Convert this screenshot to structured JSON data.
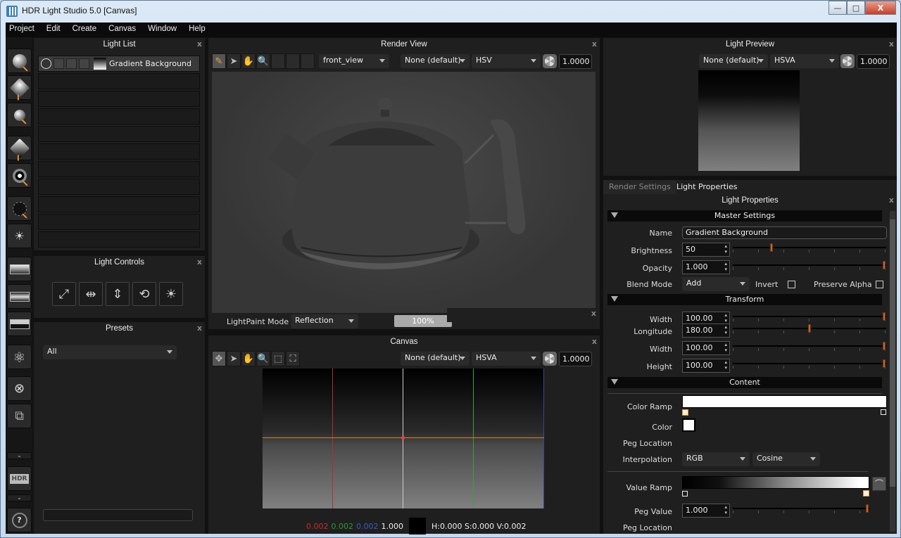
{
  "window": {
    "title": "HDR Light Studio 5.0 [Canvas]",
    "controls": {
      "minimize": "—",
      "maximize": "□",
      "close": "X"
    }
  },
  "menubar": [
    "Project",
    "Edit",
    "Create",
    "Canvas",
    "Window",
    "Help"
  ],
  "left_toolbar": {
    "buttons": [
      "add-light-circle",
      "add-light-rect",
      "add-light-spot",
      "add-light-diamond",
      "add-light-pattern",
      "add-light-ellipse",
      "add-light-sun",
      "gradient-background",
      "hdri-background",
      "sky-background",
      "atom-effects",
      "delete-light",
      "duplicate-light",
      "hdr-export",
      "help"
    ],
    "hdr_label": "HDR",
    "help_label": "?"
  },
  "light_list": {
    "title": "Light List",
    "items": [
      {
        "name": "Gradient Background",
        "selected": true
      }
    ],
    "empty_rows": 10
  },
  "light_controls": {
    "title": "Light Controls",
    "buttons": [
      "scale",
      "stretch-horizontal",
      "stretch-vertical",
      "rotate",
      "brightness"
    ]
  },
  "presets": {
    "title": "Presets",
    "filter": "All",
    "search_value": ""
  },
  "render_view": {
    "title": "Render View",
    "tools": [
      "lightpaint-brush",
      "select",
      "pan",
      "zoom"
    ],
    "camera": "front_view",
    "lut": "None (default)",
    "colorspace": "HSV",
    "exposure": "1.0000",
    "lightpaint_mode_label": "LightPaint Mode",
    "lightpaint_mode": "Reflection",
    "progress_label": "100%",
    "progress": 1.0
  },
  "canvas": {
    "title": "Canvas",
    "tools": [
      "move",
      "select",
      "pan",
      "zoom",
      "zoom-region",
      "fit"
    ],
    "lut": "None (default)",
    "colorspace": "HSVA",
    "exposure": "1.0000",
    "readout": {
      "r": "0.002",
      "g": "0.002",
      "b": "0.002",
      "a": "1.000",
      "hsv": "H:0.000 S:0.000 V:0.002"
    },
    "colors": {
      "r": "#cc2a2a",
      "g": "#2f9a2f",
      "b": "#3b5cc8",
      "crosshair": "#e07a20"
    }
  },
  "light_preview": {
    "title": "Light Preview",
    "lut": "None (default)",
    "colorspace": "HSVA",
    "exposure": "1.0000"
  },
  "properties": {
    "tabs": [
      "Render Settings",
      "Light Properties"
    ],
    "active_tab": "Light Properties",
    "title": "Light Properties",
    "master": {
      "header": "Master Settings",
      "name_label": "Name",
      "name": "Gradient Background",
      "brightness_label": "Brightness",
      "brightness": "50",
      "brightness_frac": 0.25,
      "opacity_label": "Opacity",
      "opacity": "1.000",
      "opacity_frac": 1.0,
      "blend_label": "Blend Mode",
      "blend": "Add",
      "invert_label": "Invert",
      "invert": false,
      "preserve_alpha_label": "Preserve Alpha",
      "preserve_alpha": false
    },
    "transform": {
      "header": "Transform",
      "width1_label": "Width",
      "width1": "100.00",
      "width1_frac": 1.0,
      "longitude_label": "Longitude",
      "longitude": "180.00",
      "longitude_frac": 0.5,
      "width2_label": "Width",
      "width2": "100.00",
      "width2_frac": 1.0,
      "height_label": "Height",
      "height": "100.00",
      "height_frac": 1.0
    },
    "content": {
      "header": "Content",
      "color_ramp_label": "Color Ramp",
      "color_label": "Color",
      "color": "#ffffff",
      "peg_location_label": "Peg Location",
      "interpolation_label": "Interpolation",
      "interpolation_space": "RGB",
      "interpolation_curve": "Cosine",
      "value_ramp_label": "Value Ramp",
      "peg_value_label": "Peg Value",
      "peg_value": "1.000",
      "peg_value_frac": 1.0,
      "peg_location2_label": "Peg Location"
    }
  }
}
